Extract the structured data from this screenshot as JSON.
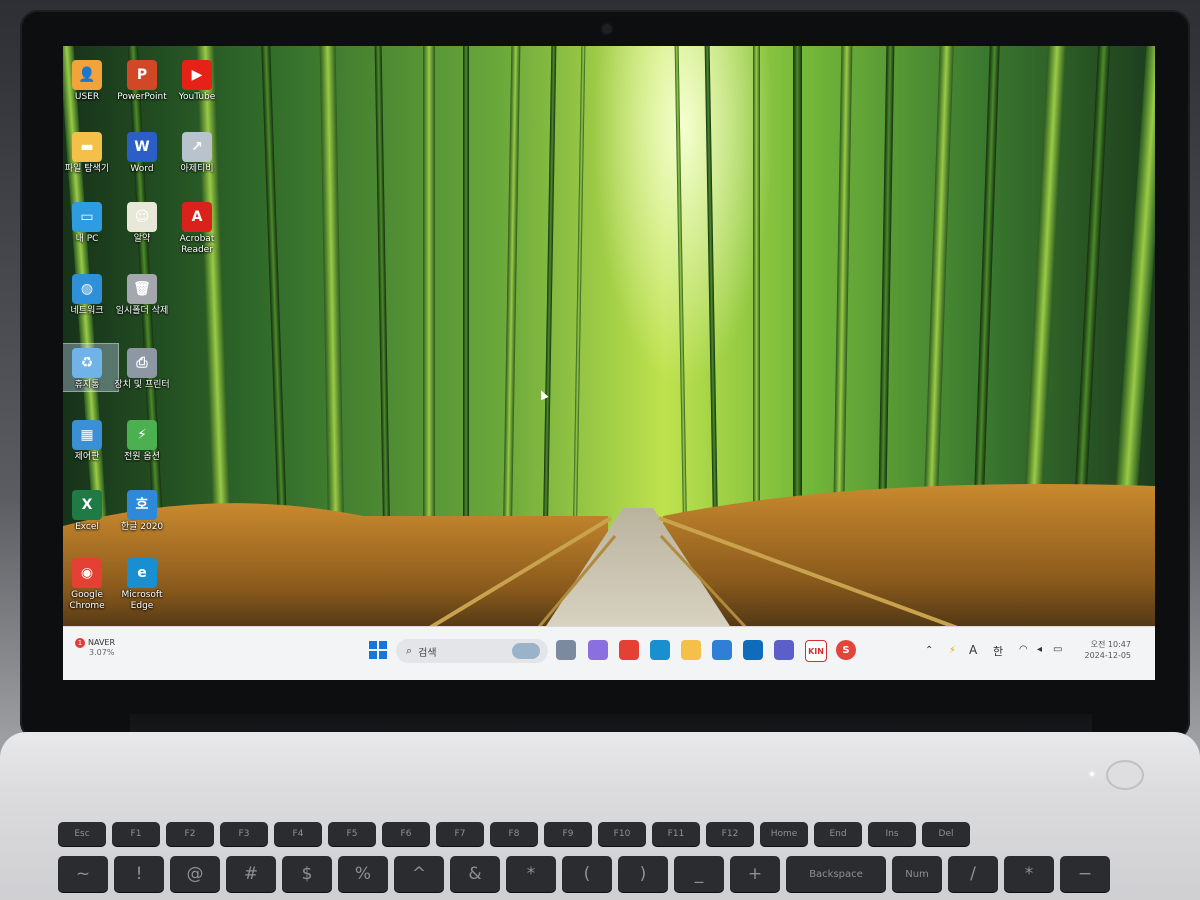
{
  "desktop": {
    "icons": [
      {
        "label": "USER",
        "icon": "user-folder-icon",
        "color": "#f2a33a",
        "glyph": "👤"
      },
      {
        "label": "PowerPoint",
        "icon": "powerpoint-icon",
        "color": "#d24726",
        "glyph": "P"
      },
      {
        "label": "YouTube",
        "icon": "youtube-icon",
        "color": "#e62117",
        "glyph": "▶"
      },
      {
        "label": "파일 탐색기",
        "icon": "file-explorer-icon",
        "color": "#f4c04a",
        "glyph": "▬"
      },
      {
        "label": "Word",
        "icon": "word-icon",
        "color": "#2b5ec7",
        "glyph": "W"
      },
      {
        "label": "아제티비",
        "icon": "ajetv-icon",
        "color": "#b9c3cc",
        "glyph": "↗"
      },
      {
        "label": "내 PC",
        "icon": "my-pc-icon",
        "color": "#2f9be0",
        "glyph": "▭"
      },
      {
        "label": "알약",
        "icon": "alyac-icon",
        "color": "#e8e8d8",
        "glyph": "☺"
      },
      {
        "label": "Acrobat Reader",
        "icon": "acrobat-reader-icon",
        "color": "#d9221c",
        "glyph": "A"
      },
      {
        "label": "네트워크",
        "icon": "network-icon",
        "color": "#2f8fd8",
        "glyph": "◍"
      },
      {
        "label": "임시폴더 삭제",
        "icon": "trash-temp-icon",
        "color": "#a4a8ae",
        "glyph": "🗑"
      },
      {
        "label": "휴지통",
        "icon": "recycle-bin-icon",
        "color": "#6fb3e8",
        "glyph": "♻"
      },
      {
        "label": "장치 및 프린터",
        "icon": "devices-printers-icon",
        "color": "#8d98a4",
        "glyph": "⎙"
      },
      {
        "label": "제어판",
        "icon": "control-panel-icon",
        "color": "#3a8fd5",
        "glyph": "▦"
      },
      {
        "label": "전원 옵션",
        "icon": "power-options-icon",
        "color": "#4caf50",
        "glyph": "⚡"
      },
      {
        "label": "Excel",
        "icon": "excel-icon",
        "color": "#1f7a45",
        "glyph": "X"
      },
      {
        "label": "한글 2020",
        "icon": "hangul-2020-icon",
        "color": "#2e8ad8",
        "glyph": "호"
      },
      {
        "label": "Google Chrome",
        "icon": "chrome-icon",
        "color": "#e44134",
        "glyph": "◉"
      },
      {
        "label": "Microsoft Edge",
        "icon": "edge-icon",
        "color": "#1a8fd0",
        "glyph": "e"
      }
    ]
  },
  "taskbar": {
    "weather_brand": "NAVER",
    "weather_sub": "3.07%",
    "weather_badge": "1",
    "search_placeholder": "검색",
    "tray_lang": "A",
    "tray_ime": "한",
    "clock_time": "오전 10:47",
    "clock_date": "2024-12-05",
    "apps": [
      {
        "name": "widgets-icon",
        "color": "#7c8aa0"
      },
      {
        "name": "copilot-icon",
        "color": "#8a6fe0"
      },
      {
        "name": "chrome-icon",
        "color": "#e44134"
      },
      {
        "name": "edge-icon",
        "color": "#1a8fd0"
      },
      {
        "name": "file-explorer-icon",
        "color": "#f4c04a"
      },
      {
        "name": "store-icon",
        "color": "#2f7fd6"
      },
      {
        "name": "outlook-icon",
        "color": "#0f6cbd"
      },
      {
        "name": "teams-icon",
        "color": "#5b5fc7"
      },
      {
        "name": "kin-icon",
        "color": "#ffffff"
      },
      {
        "name": "s-app-icon",
        "color": "#e2463a"
      }
    ],
    "kin_label": "KIN",
    "s_label": "S"
  },
  "keyboard": {
    "fn_row": [
      "Esc",
      "F1",
      "F2",
      "F3",
      "F4",
      "F5",
      "F6",
      "F7",
      "F8",
      "F9",
      "F10",
      "F11",
      "F12",
      "Home",
      "End",
      "Ins",
      "Del"
    ],
    "num_row": [
      "~",
      "!",
      "@",
      "#",
      "$",
      "%",
      "^",
      "&",
      "*",
      "(",
      ")",
      "_",
      "+",
      "Backspace",
      "Num",
      "/",
      "*",
      "−"
    ]
  }
}
